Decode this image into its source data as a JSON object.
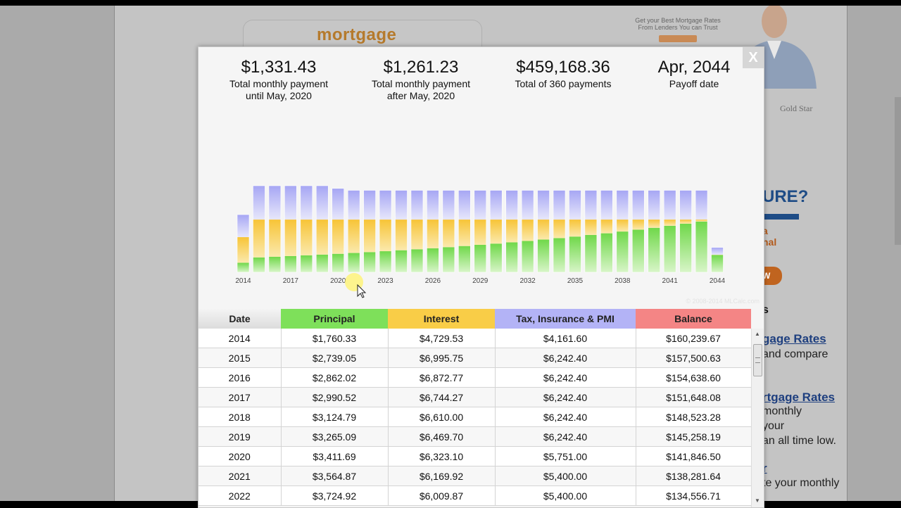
{
  "background": {
    "logo_text": "mortgage",
    "ad_line1": "Get your Best Mortgage Rates",
    "ad_line2": "From Lenders You can Trust",
    "gold_star": "Gold Star",
    "headline": "URE?",
    "orange_line1": "a",
    "orange_line2": "nal",
    "now_button": "W",
    "s_fragment": "s",
    "link1": "gage Rates",
    "text1": "and compare",
    "link2": "rtgage Rates",
    "text2": "monthly",
    "text3": "your",
    "text4": "an all time low.",
    "link3": "r",
    "text5": "te your monthly"
  },
  "modal": {
    "close_label": "X",
    "summary": [
      {
        "amount": "$1,331.43",
        "label1": "Total monthly payment",
        "label2": "until May, 2020"
      },
      {
        "amount": "$1,261.23",
        "label1": "Total monthly payment",
        "label2": "after May, 2020"
      },
      {
        "amount": "$459,168.36",
        "label1": "Total of 360 payments",
        "label2": ""
      },
      {
        "amount": "Apr, 2044",
        "label1": "Payoff date",
        "label2": ""
      }
    ],
    "copyright": "© 2008-2014 MLCalc.com"
  },
  "colors": {
    "principal": "#6fdc45",
    "interest": "#f8c83a",
    "tax": "#aaaaf5",
    "balance": "#f27b7b"
  },
  "chart_data": {
    "type": "bar",
    "stacked": true,
    "categories": [
      "2014",
      "2015",
      "2016",
      "2017",
      "2018",
      "2019",
      "2020",
      "2021",
      "2022",
      "2023",
      "2024",
      "2025",
      "2026",
      "2027",
      "2028",
      "2029",
      "2030",
      "2031",
      "2032",
      "2033",
      "2034",
      "2035",
      "2036",
      "2037",
      "2038",
      "2039",
      "2040",
      "2041",
      "2042",
      "2043",
      "2044"
    ],
    "tick_labels": [
      "2014",
      "2017",
      "2020",
      "2023",
      "2026",
      "2029",
      "2032",
      "2035",
      "2038",
      "2041",
      "2044"
    ],
    "series": [
      {
        "name": "Principal",
        "values": [
          1760.33,
          2739.05,
          2862.02,
          2990.52,
          3124.79,
          3265.09,
          3411.69,
          3564.87,
          3724.92,
          3892.16,
          4066.91,
          4249.51,
          4440.3,
          4639.66,
          4847.97,
          5065.63,
          5293.07,
          5530.71,
          5779.03,
          6038.49,
          6309.61,
          6592.89,
          6888.9,
          7198.19,
          7521.37,
          7859.06,
          8211.91,
          8580.62,
          8965.86,
          9368.41,
          3200.0
        ]
      },
      {
        "name": "Interest",
        "values": [
          4729.53,
          6995.75,
          6872.77,
          6744.27,
          6610.0,
          6469.7,
          6323.1,
          6169.92,
          6009.87,
          5842.63,
          5667.88,
          5485.28,
          5294.49,
          5095.13,
          4886.82,
          4669.16,
          4441.72,
          4204.08,
          3955.76,
          3696.3,
          3425.18,
          3141.9,
          2845.89,
          2536.6,
          2213.42,
          1875.73,
          1522.88,
          1154.17,
          768.93,
          366.38,
          50.0
        ]
      },
      {
        "name": "Tax, Insurance & PMI",
        "values": [
          4161.6,
          6242.4,
          6242.4,
          6242.4,
          6242.4,
          6242.4,
          5751.0,
          5400.0,
          5400.0,
          5400.0,
          5400.0,
          5400.0,
          5400.0,
          5400.0,
          5400.0,
          5400.0,
          5400.0,
          5400.0,
          5400.0,
          5400.0,
          5400.0,
          5400.0,
          5400.0,
          5400.0,
          5400.0,
          5400.0,
          5400.0,
          5400.0,
          5400.0,
          5400.0,
          1350.0
        ]
      }
    ]
  },
  "table": {
    "headers": [
      "Date",
      "Principal",
      "Interest",
      "Tax, Insurance & PMI",
      "Balance"
    ],
    "rows": [
      [
        "2014",
        "$1,760.33",
        "$4,729.53",
        "$4,161.60",
        "$160,239.67"
      ],
      [
        "2015",
        "$2,739.05",
        "$6,995.75",
        "$6,242.40",
        "$157,500.63"
      ],
      [
        "2016",
        "$2,862.02",
        "$6,872.77",
        "$6,242.40",
        "$154,638.60"
      ],
      [
        "2017",
        "$2,990.52",
        "$6,744.27",
        "$6,242.40",
        "$151,648.08"
      ],
      [
        "2018",
        "$3,124.79",
        "$6,610.00",
        "$6,242.40",
        "$148,523.28"
      ],
      [
        "2019",
        "$3,265.09",
        "$6,469.70",
        "$6,242.40",
        "$145,258.19"
      ],
      [
        "2020",
        "$3,411.69",
        "$6,323.10",
        "$5,751.00",
        "$141,846.50"
      ],
      [
        "2021",
        "$3,564.87",
        "$6,169.92",
        "$5,400.00",
        "$138,281.64"
      ],
      [
        "2022",
        "$3,724.92",
        "$6,009.87",
        "$5,400.00",
        "$134,556.71"
      ]
    ]
  }
}
